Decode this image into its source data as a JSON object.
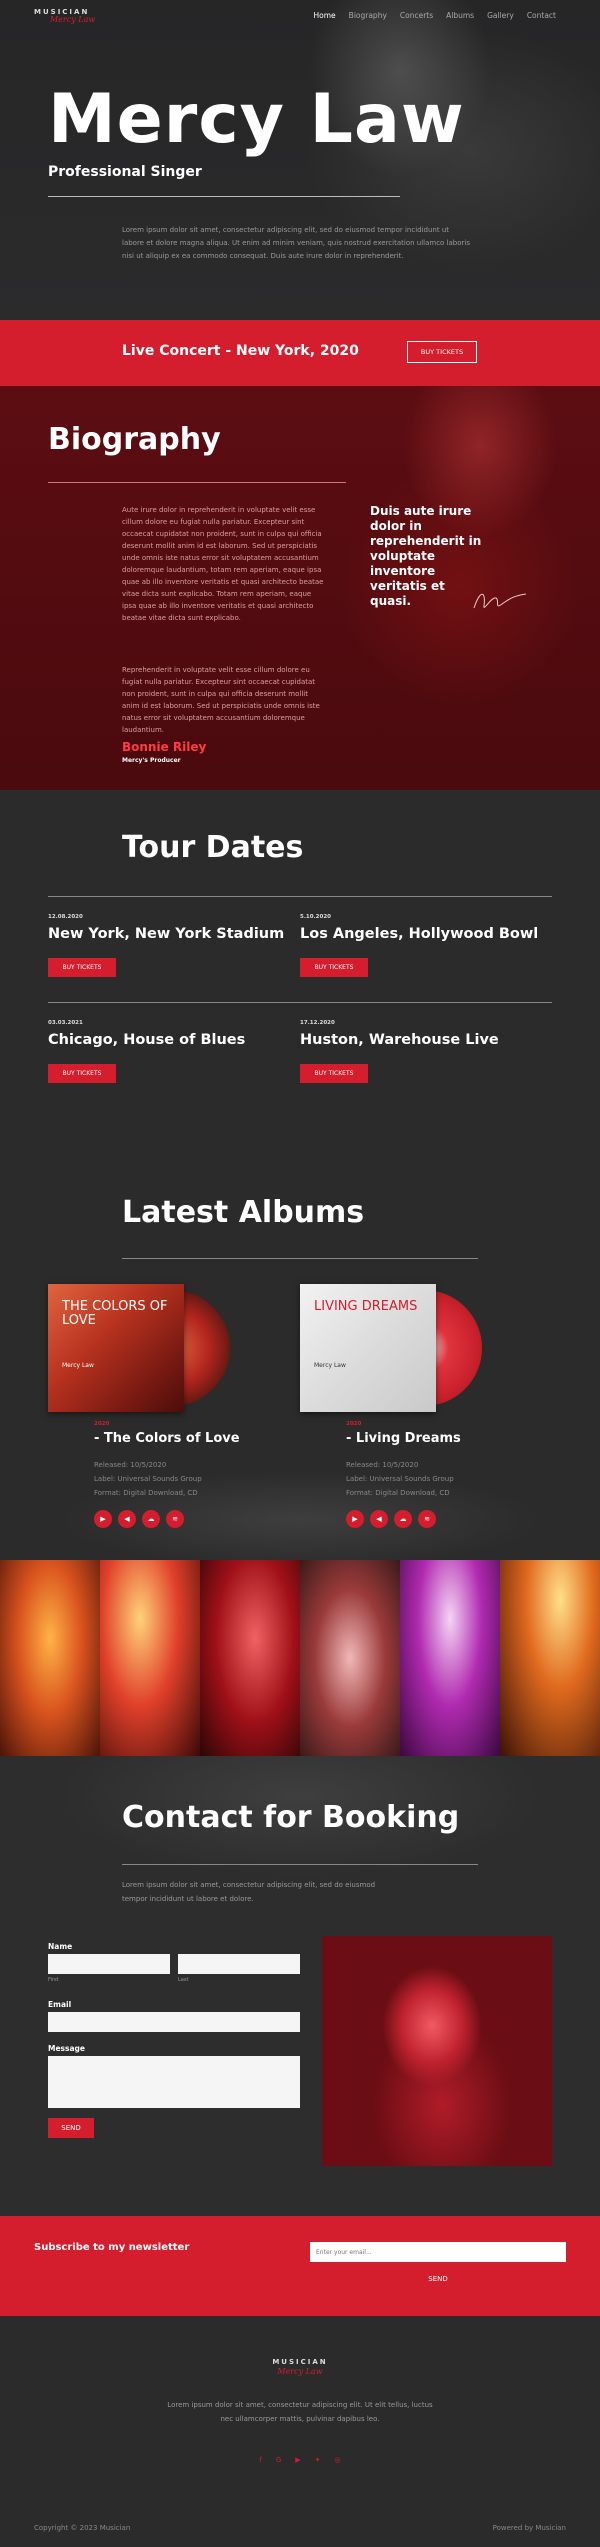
{
  "brand": {
    "top": "MUSICIAN",
    "script": "Mercy Law"
  },
  "nav": {
    "items": [
      "Home",
      "Biography",
      "Concerts",
      "Albums",
      "Gallery",
      "Contact"
    ]
  },
  "hero": {
    "title": "Mercy Law",
    "subtitle": "Professional Singer",
    "text": "Lorem ipsum dolor sit amet, consectetur adipiscing elit, sed do eiusmod tempor incididunt ut labore et dolore magna aliqua. Ut enim ad minim veniam, quis nostrud exercitation ullamco laboris nisi ut aliquip ex ea commodo consequat. Duis aute irure dolor in reprehenderit."
  },
  "concert": {
    "title": "Live Concert - New York, 2020",
    "button": "BUY TICKETS"
  },
  "biography": {
    "title": "Biography",
    "text1": "Aute irure dolor in reprehenderit in voluptate velit esse cillum dolore eu fugiat nulla pariatur. Excepteur sint occaecat cupidatat non proident, sunt in culpa qui officia deserunt mollit anim id est laborum. Sed ut perspiciatis unde omnis iste natus error sit voluptatem accusantium doloremque laudantium, totam rem aperiam, eaque ipsa quae ab illo inventore veritatis et quasi architecto beatae vitae dicta sunt explicabo. Totam rem aperiam, eaque ipsa quae ab illo inventore veritatis et quasi architecto beatae vitae dicta sunt explicabo.",
    "text2": "Reprehenderit in voluptate velit esse cillum dolore eu fugiat nulla pariatur. Excepteur sint occaecat cupidatat non proident, sunt in culpa qui officia deserunt mollit anim id est laborum. Sed ut perspiciatis unde omnis iste natus error sit voluptatem accusantium doloremque laudantium.",
    "author": "Bonnie Riley",
    "role": "Mercy's Producer",
    "quote": "Duis aute irure dolor in reprehenderit in voluptate inventore veritatis et quasi."
  },
  "tour": {
    "title": "Tour Dates",
    "items": [
      {
        "date": "12.08.2020",
        "venue": "New York, New York Stadium",
        "button": "BUY TICKETS"
      },
      {
        "date": "5.10.2020",
        "venue": "Los Angeles, Hollywood Bowl",
        "button": "BUY TICKETS"
      },
      {
        "date": "03.03.2021",
        "venue": "Chicago, House of Blues",
        "button": "BUY TICKETS"
      },
      {
        "date": "17.12.2020",
        "venue": "Huston, Warehouse Live",
        "button": "BUY TICKETS"
      }
    ]
  },
  "albums": {
    "title": "Latest Albums",
    "items": [
      {
        "cover_title": "THE COLORS OF LOVE",
        "cover_artist": "Mercy Law",
        "year": "2020",
        "name": "- The Colors of Love",
        "released": "Released: 10/5/2020",
        "label": "Label: Universal Sounds Group",
        "format": "Format: Digital Download, CD"
      },
      {
        "cover_title": "LIVING DREAMS",
        "cover_artist": "Mercy Law",
        "year": "2020",
        "name": "- Living Dreams",
        "released": "Released: 10/5/2020",
        "label": "Label: Universal Sounds Group",
        "format": "Format: Digital Download, CD"
      }
    ],
    "icons": [
      "play-icon",
      "volume-icon",
      "cloud-icon",
      "spotify-icon"
    ]
  },
  "contact": {
    "title": "Contact for Booking",
    "text": "Lorem ipsum dolor sit amet, consectetur adipiscing elit, sed do eiusmod tempor incididunt ut labore et dolore.",
    "name_label": "Name",
    "first_sub": "First",
    "last_sub": "Last",
    "email_label": "Email",
    "message_label": "Message",
    "send": "SEND"
  },
  "newsletter": {
    "title": "Subscribe to my newsletter",
    "placeholder": "Enter your email...",
    "send": "SEND"
  },
  "footer": {
    "text": "Lorem ipsum dolor sit amet, consectetur adipiscing elit. Ut elit tellus, luctus nec ullamcorper mattis, pulvinar dapibus leo.",
    "copyright": "Copyright © 2023 Musician",
    "powered": "Powered by Musician",
    "social": [
      "facebook-icon",
      "google-icon",
      "youtube-icon",
      "twitter-icon",
      "instagram-icon"
    ]
  },
  "colors": {
    "accent": "#d41d2d",
    "dark": "#2b2b2c",
    "bio_bg": "#4a0a0e"
  }
}
